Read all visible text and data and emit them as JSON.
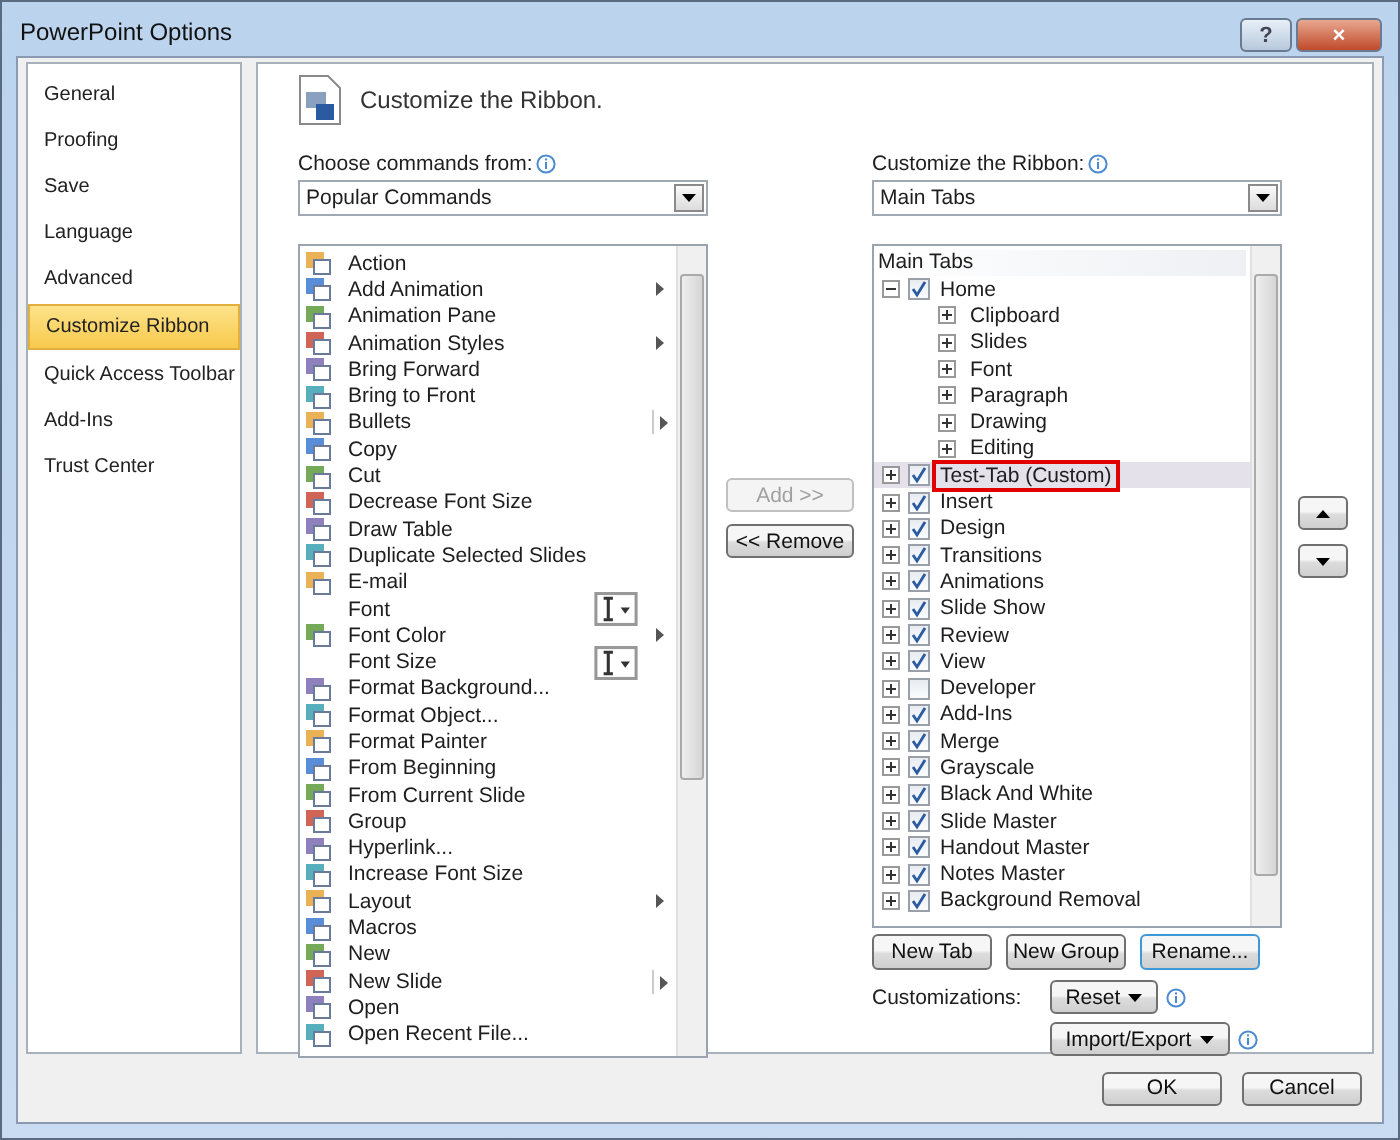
{
  "window": {
    "title": "PowerPoint Options",
    "help": "?",
    "close": "×"
  },
  "sidebar": {
    "items": [
      {
        "label": "General",
        "selected": false
      },
      {
        "label": "Proofing",
        "selected": false
      },
      {
        "label": "Save",
        "selected": false
      },
      {
        "label": "Language",
        "selected": false
      },
      {
        "label": "Advanced",
        "selected": false
      },
      {
        "label": "Customize Ribbon",
        "selected": true
      },
      {
        "label": "Quick Access Toolbar",
        "selected": false
      },
      {
        "label": "Add-Ins",
        "selected": false
      },
      {
        "label": "Trust Center",
        "selected": false
      }
    ]
  },
  "heading": "Customize the Ribbon.",
  "commands": {
    "label": "Choose commands from:",
    "value": "Popular Commands",
    "items": [
      {
        "label": "Action",
        "kind": "plain"
      },
      {
        "label": "Add Animation",
        "kind": "submenu"
      },
      {
        "label": "Animation Pane",
        "kind": "plain"
      },
      {
        "label": "Animation Styles",
        "kind": "submenu"
      },
      {
        "label": "Bring Forward",
        "kind": "plain"
      },
      {
        "label": "Bring to Front",
        "kind": "plain"
      },
      {
        "label": "Bullets",
        "kind": "split"
      },
      {
        "label": "Copy",
        "kind": "plain"
      },
      {
        "label": "Cut",
        "kind": "plain"
      },
      {
        "label": "Decrease Font Size",
        "kind": "plain"
      },
      {
        "label": "Draw Table",
        "kind": "plain"
      },
      {
        "label": "Duplicate Selected Slides",
        "kind": "plain"
      },
      {
        "label": "E-mail",
        "kind": "plain"
      },
      {
        "label": "Font",
        "kind": "fontbox"
      },
      {
        "label": "Font Color",
        "kind": "submenu"
      },
      {
        "label": "Font Size",
        "kind": "fontbox"
      },
      {
        "label": "Format Background...",
        "kind": "plain"
      },
      {
        "label": "Format Object...",
        "kind": "plain"
      },
      {
        "label": "Format Painter",
        "kind": "plain"
      },
      {
        "label": "From Beginning",
        "kind": "plain"
      },
      {
        "label": "From Current Slide",
        "kind": "plain"
      },
      {
        "label": "Group",
        "kind": "plain"
      },
      {
        "label": "Hyperlink...",
        "kind": "plain"
      },
      {
        "label": "Increase Font Size",
        "kind": "plain"
      },
      {
        "label": "Layout",
        "kind": "submenu"
      },
      {
        "label": "Macros",
        "kind": "plain"
      },
      {
        "label": "New",
        "kind": "plain"
      },
      {
        "label": "New Slide",
        "kind": "split"
      },
      {
        "label": "Open",
        "kind": "plain"
      },
      {
        "label": "Open Recent File...",
        "kind": "plain"
      }
    ]
  },
  "middle_buttons": [
    {
      "label": "Add >>",
      "disabled": true
    },
    {
      "label": "<< Remove",
      "disabled": false
    }
  ],
  "ribbon": {
    "label": "Customize the Ribbon:",
    "value": "Main Tabs",
    "header": "Main Tabs",
    "tabs": [
      {
        "label": "Home",
        "checked": true,
        "expanded": true,
        "selected": false,
        "children": [
          {
            "label": "Clipboard"
          },
          {
            "label": "Slides"
          },
          {
            "label": "Font"
          },
          {
            "label": "Paragraph"
          },
          {
            "label": "Drawing"
          },
          {
            "label": "Editing"
          }
        ]
      },
      {
        "label": "Test-Tab (Custom)",
        "checked": true,
        "expanded": false,
        "selected": true
      },
      {
        "label": "Insert",
        "checked": true,
        "expanded": false,
        "selected": false
      },
      {
        "label": "Design",
        "checked": true,
        "expanded": false,
        "selected": false
      },
      {
        "label": "Transitions",
        "checked": true,
        "expanded": false,
        "selected": false
      },
      {
        "label": "Animations",
        "checked": true,
        "expanded": false,
        "selected": false
      },
      {
        "label": "Slide Show",
        "checked": true,
        "expanded": false,
        "selected": false
      },
      {
        "label": "Review",
        "checked": true,
        "expanded": false,
        "selected": false
      },
      {
        "label": "View",
        "checked": true,
        "expanded": false,
        "selected": false
      },
      {
        "label": "Developer",
        "checked": false,
        "expanded": false,
        "selected": false
      },
      {
        "label": "Add-Ins",
        "checked": true,
        "expanded": false,
        "selected": false
      },
      {
        "label": "Merge",
        "checked": true,
        "expanded": false,
        "selected": false
      },
      {
        "label": "Grayscale",
        "checked": true,
        "expanded": false,
        "selected": false
      },
      {
        "label": "Black And White",
        "checked": true,
        "expanded": false,
        "selected": false
      },
      {
        "label": "Slide Master",
        "checked": true,
        "expanded": false,
        "selected": false
      },
      {
        "label": "Handout Master",
        "checked": true,
        "expanded": false,
        "selected": false
      },
      {
        "label": "Notes Master",
        "checked": true,
        "expanded": false,
        "selected": false
      },
      {
        "label": "Background Removal",
        "checked": true,
        "expanded": false,
        "selected": false
      }
    ]
  },
  "tree_buttons": [
    "New Tab",
    "New Group",
    "Rename..."
  ],
  "customizations": {
    "label": "Customizations:",
    "reset": "Reset",
    "import_export": "Import/Export"
  },
  "footer_buttons": [
    "OK",
    "Cancel"
  ]
}
